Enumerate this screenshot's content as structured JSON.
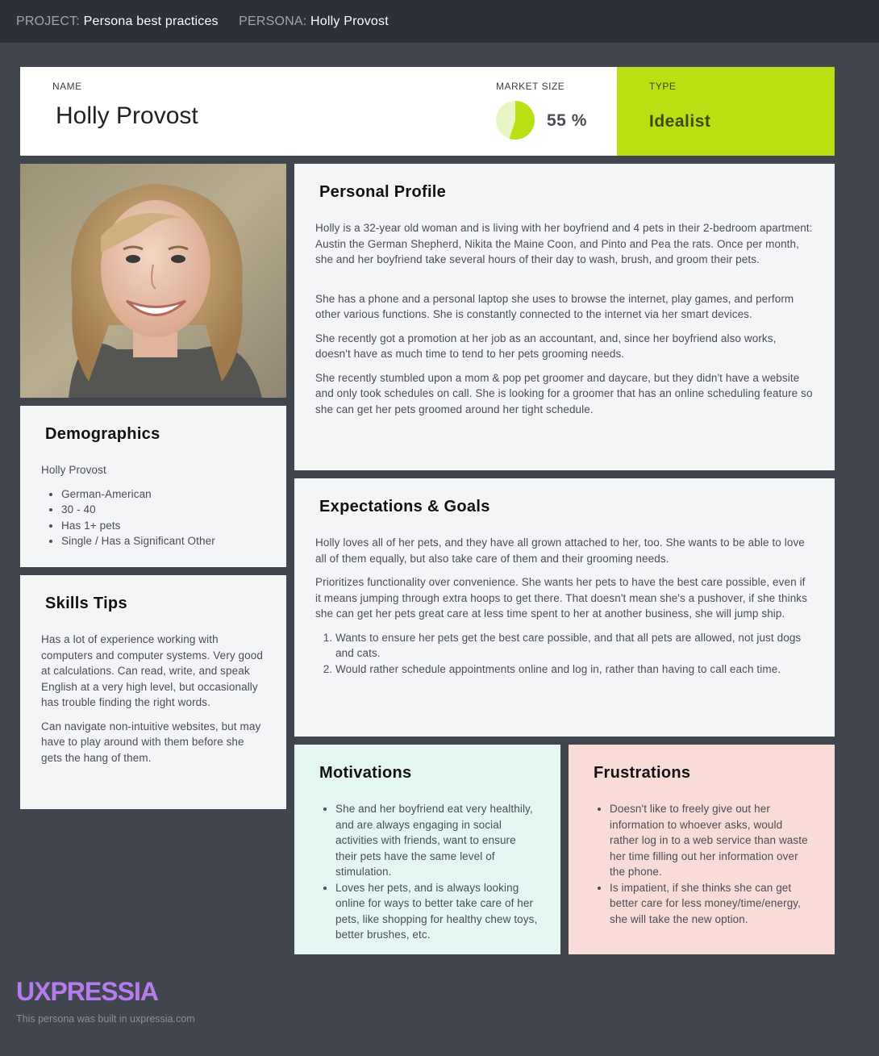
{
  "topbar": {
    "project_label": "PROJECT:",
    "project_value": "Persona best practices",
    "persona_label": "PERSONA:",
    "persona_value": "Holly Provost"
  },
  "header": {
    "name_label": "NAME",
    "name_value": "Holly Provost",
    "market_label": "MARKET SIZE",
    "market_percent": 55,
    "market_value": "55 %",
    "type_label": "TYPE",
    "type_value": "Idealist"
  },
  "colors": {
    "type_accent": "#b8e012",
    "pie_fill": "#b8e012",
    "pie_track": "#e8f5c4",
    "motivations_bg": "#e3f6f1",
    "frustrations_bg": "#f9dcd8",
    "brand": "#b77bf0"
  },
  "demographics": {
    "title": "Demographics",
    "name": "Holly Provost",
    "items": [
      "German-American",
      "30 - 40",
      "Has 1+ pets",
      "Single / Has a Significant Other"
    ]
  },
  "skills": {
    "title": "Skills Tips",
    "paragraphs": [
      "Has a lot of experience working with computers and computer systems. Very good at calculations. Can read, write, and speak English at a very high level, but occasionally has trouble finding the right words.",
      "Can navigate non-intuitive websites, but may have to play around with them before she gets the hang of them."
    ]
  },
  "profile": {
    "title": "Personal Profile",
    "paragraphs": [
      "Holly is a 32-year old woman and is living with her boyfriend and 4 pets in their 2-bedroom apartment: Austin the German Shepherd, Nikita the Maine Coon, and Pinto and Pea the rats. Once per month, she and her boyfriend take several hours of their day to wash, brush, and groom their pets.",
      "She has a phone and a personal laptop she uses to browse the internet, play games, and perform other various functions. She is constantly connected to the internet via her smart devices.",
      "She recently got a promotion at her job as an accountant, and, since her boyfriend also works, doesn't have as much time to tend to her pets grooming needs.",
      "She recently stumbled upon a mom & pop pet groomer and daycare, but they didn't have a website and only took schedules on call. She is looking for a groomer that has an online scheduling feature so she can get her pets groomed around her tight schedule."
    ]
  },
  "goals": {
    "title": "Expectations & Goals",
    "paragraphs": [
      "Holly loves all of her pets, and they have all grown attached to her, too. She wants to be able to love all of them equally, but also take care of them and their grooming needs.",
      "Prioritizes functionality over convenience. She wants her pets to have the best care possible, even if it means jumping through extra hoops to get there. That doesn't mean she's a pushover, if she thinks she can get her pets great care at less time spent to her at another business, she will jump ship."
    ],
    "list": [
      "Wants to ensure her pets get the best care possible, and that all pets are allowed, not just dogs and cats.",
      "Would rather schedule appointments online and log in, rather than having to call each time."
    ]
  },
  "motivations": {
    "title": "Motivations",
    "items": [
      "She and her boyfriend eat very healthily, and are always engaging in social activities with friends, want to ensure their pets have the same level of stimulation.",
      "Loves her pets, and is always looking online for ways to better take care of her pets, like shopping for healthy chew toys, better brushes, etc."
    ]
  },
  "frustrations": {
    "title": "Frustrations",
    "items": [
      "Doesn't like to freely give out her information to whoever asks, would rather log in to a web service than waste her time filling out her information over the phone.",
      "Is impatient, if she thinks she can get better care for less money/time/energy, she will take the new option."
    ]
  },
  "footer": {
    "logo": "UXPRESSIA",
    "note": "This persona was built in uxpressia.com"
  }
}
